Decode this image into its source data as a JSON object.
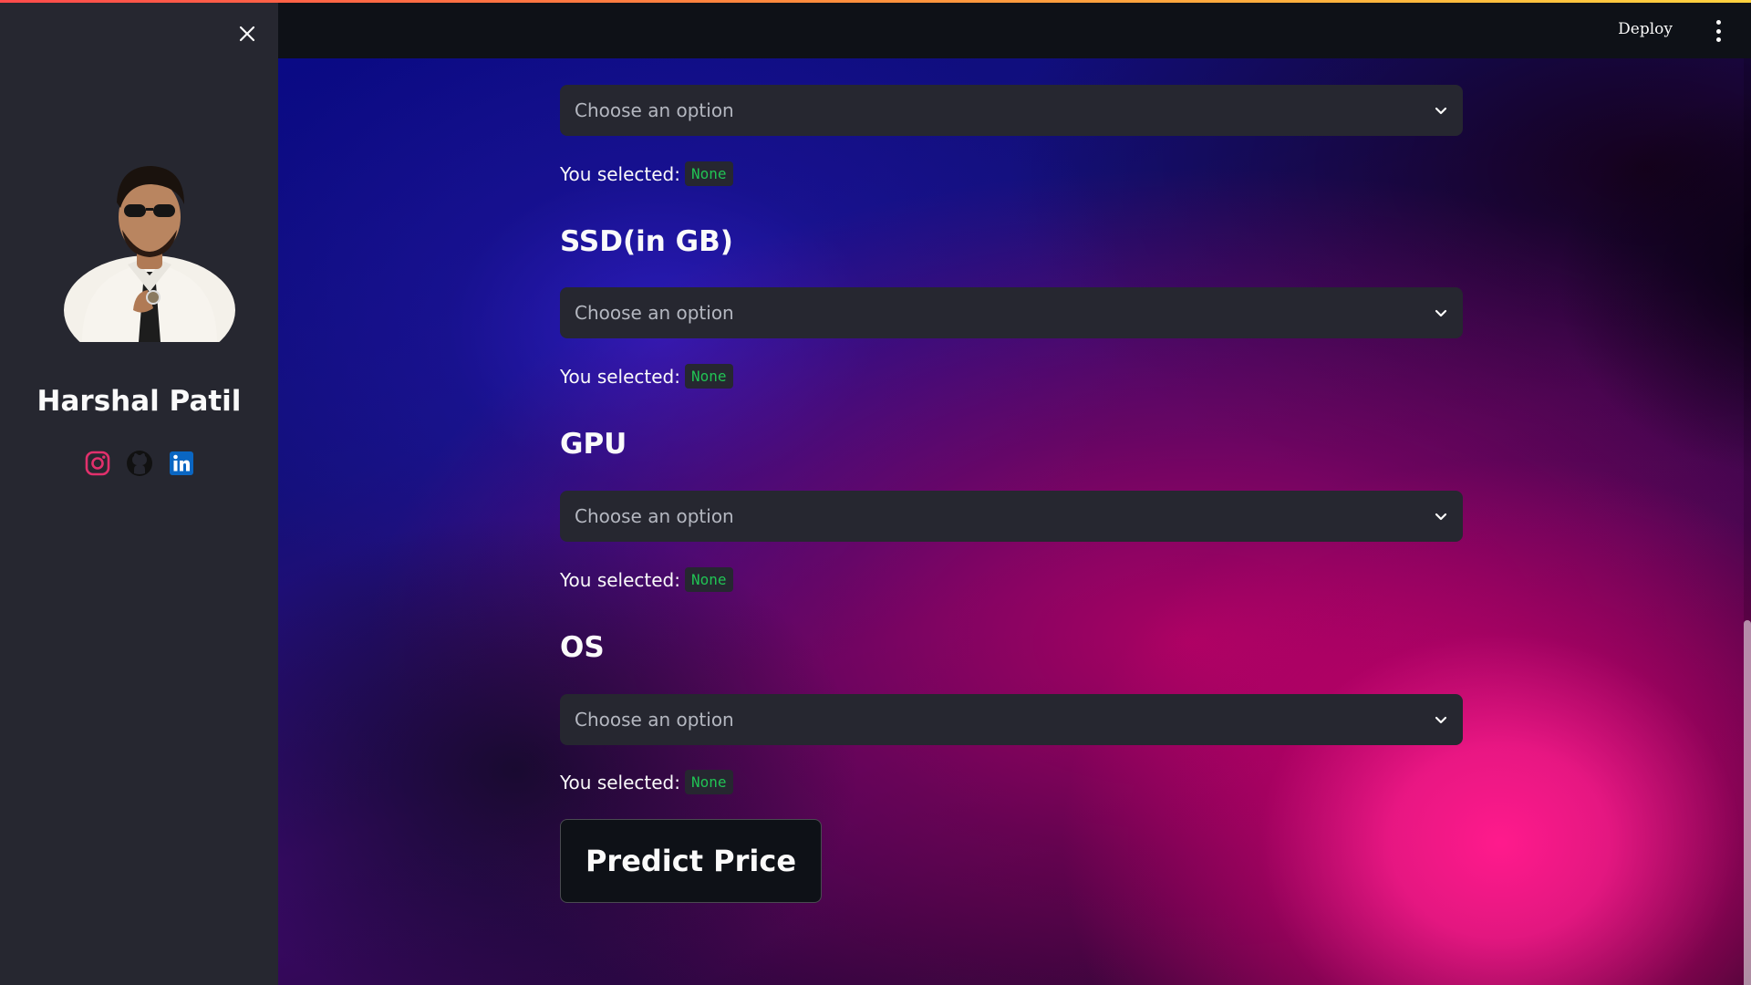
{
  "sidebar": {
    "author_name": "Harshal Patil",
    "avatar_icon": "user-avatar",
    "close_icon": "close-icon",
    "social": [
      {
        "name": "instagram-icon",
        "color": "#e1306c"
      },
      {
        "name": "github-icon",
        "color": "#111111"
      },
      {
        "name": "linkedin-icon",
        "color": "#0a66c2"
      }
    ]
  },
  "header": {
    "deploy_label": "Deploy",
    "menu_icon": "more-vertical-icon"
  },
  "main": {
    "fields": [
      {
        "title": "",
        "placeholder": "Choose an option",
        "selected_label": "You selected:",
        "selected_value": "None"
      },
      {
        "title": "SSD(in GB)",
        "placeholder": "Choose an option",
        "selected_label": "You selected:",
        "selected_value": "None"
      },
      {
        "title": "GPU",
        "placeholder": "Choose an option",
        "selected_label": "You selected:",
        "selected_value": "None"
      },
      {
        "title": "OS",
        "placeholder": "Choose an option",
        "selected_label": "You selected:",
        "selected_value": "None"
      }
    ],
    "predict_label": "Predict Price"
  },
  "colors": {
    "sidebar_bg": "#262730",
    "header_bg": "#0e1117",
    "select_bg": "#262730",
    "badge_text": "#21c354",
    "accent_pink": "#ff1a8c"
  }
}
